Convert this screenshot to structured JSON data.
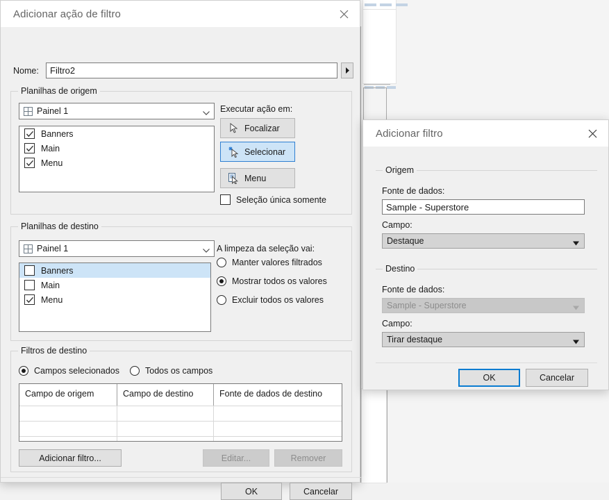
{
  "background": {
    "name": "tableau-dashboard-canvas"
  },
  "filter_action_dialog": {
    "title": "Adicionar ação de filtro",
    "close_icon": "close-icon",
    "name_label": "Nome:",
    "name_value": "Filtro2",
    "name_dropdown_icon": "triangle-right-icon",
    "source_group": {
      "label": "Planilhas de origem",
      "sheet_combo": {
        "value": "Painel 1",
        "icon": "dashboard-grid-icon",
        "chevron": "chevron-down-icon"
      },
      "sheets": [
        {
          "label": "Banners",
          "checked": true,
          "selected": false
        },
        {
          "label": "Main",
          "checked": true,
          "selected": false
        },
        {
          "label": "Menu",
          "checked": true,
          "selected": false
        }
      ],
      "run_action_label": "Executar ação em:",
      "run_buttons": [
        {
          "label": "Focalizar",
          "icon": "pointer-arrow-icon",
          "active": false
        },
        {
          "label": "Selecionar",
          "icon": "pointer-select-icon",
          "active": true
        },
        {
          "label": "Menu",
          "icon": "pointer-menu-icon",
          "active": false
        }
      ],
      "single_select_label": "Seleção única somente",
      "single_select_checked": false
    },
    "target_group": {
      "label": "Planilhas de destino",
      "sheet_combo": {
        "value": "Painel 1",
        "icon": "dashboard-grid-icon",
        "chevron": "chevron-down-icon"
      },
      "sheets": [
        {
          "label": "Banners",
          "checked": false,
          "selected": true
        },
        {
          "label": "Main",
          "checked": false,
          "selected": false
        },
        {
          "label": "Menu",
          "checked": true,
          "selected": false
        }
      ],
      "clearing_label": "A limpeza da seleção vai:",
      "clearing_options": [
        {
          "label": "Manter valores filtrados",
          "selected": false
        },
        {
          "label": "Mostrar todos os valores",
          "selected": true
        },
        {
          "label": "Excluir todos os valores",
          "selected": false
        }
      ]
    },
    "target_filters_group": {
      "label": "Filtros de destino",
      "field_scope": [
        {
          "label": "Campos selecionados",
          "selected": true
        },
        {
          "label": "Todos os campos",
          "selected": false
        }
      ],
      "table": {
        "columns": [
          "Campo de origem",
          "Campo de destino",
          "Fonte de dados de destino"
        ],
        "rows": [],
        "empty_row_count": 3
      },
      "add_filter_button": "Adicionar filtro...",
      "edit_button": {
        "label": "Editar...",
        "disabled": true
      },
      "remove_button": {
        "label": "Remover",
        "disabled": true
      }
    },
    "ok_button": "OK",
    "cancel_button": "Cancelar"
  },
  "add_filter_dialog": {
    "title": "Adicionar filtro",
    "close_icon": "close-icon",
    "origin_group": {
      "label": "Origem",
      "datasource_label": "Fonte de dados:",
      "datasource_value": "Sample - Superstore",
      "datasource_disabled": false,
      "field_label": "Campo:",
      "field_value": "Destaque",
      "field_chevron": "chevron-down-icon"
    },
    "destination_group": {
      "label": "Destino",
      "datasource_label": "Fonte de dados:",
      "datasource_value": "Sample - Superstore",
      "datasource_disabled": true,
      "field_label": "Campo:",
      "field_value": "Tirar destaque",
      "field_chevron": "chevron-down-icon"
    },
    "ok_button": "OK",
    "cancel_button": "Cancelar",
    "ok_focused": true
  },
  "colors": {
    "accent_blue": "#0a7cd1",
    "selection_blue": "#cde4f7",
    "dialog_bg": "#f0f0f0",
    "titlebar_bg": "#ffffff",
    "title_text": "#646464",
    "canvas_bg": "#f4f4f4"
  }
}
